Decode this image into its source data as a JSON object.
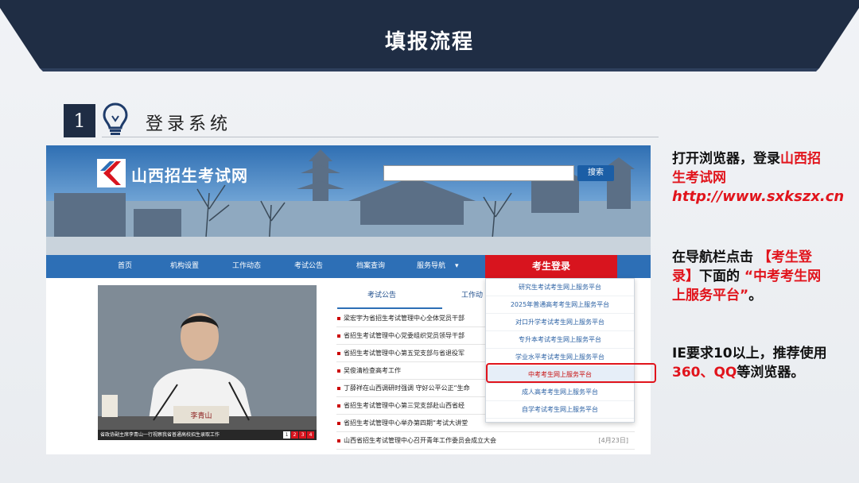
{
  "slide": {
    "title": "填报流程",
    "step_number": "1",
    "step_title": "登录系统"
  },
  "site": {
    "name": "山西招生考试网",
    "search_placeholder": "",
    "search_button": "搜索"
  },
  "nav": {
    "items": [
      "首页",
      "机构设置",
      "工作动态",
      "考试公告",
      "档案查询",
      "服务导航"
    ],
    "login": "考生登录",
    "dropdown_caret": "▾"
  },
  "photo": {
    "caption": "省政协副主席李青山一行视察我省普通高校招生录取工作",
    "name_plate": "李青山",
    "pages": [
      "1",
      "2",
      "3",
      "4"
    ]
  },
  "tabs": {
    "announcements": "考试公告",
    "news": "工作动"
  },
  "news": [
    {
      "title": "梁宏宇为省招生考试管理中心全体党员干部",
      "date": ""
    },
    {
      "title": "省招生考试管理中心党委组织党员领导干部",
      "date": ""
    },
    {
      "title": "省招生考试管理中心第五党支部与省退役军",
      "date": ""
    },
    {
      "title": "吴俊清检查高考工作",
      "date": ""
    },
    {
      "title": "丁薛祥在山西调研时强调 守好公平公正“生命",
      "date": ""
    },
    {
      "title": "省招生考试管理中心第三党支部赴山西省经",
      "date": ""
    },
    {
      "title": "省招生考试管理中心举办第四期“考试大讲堂",
      "date": ""
    },
    {
      "title": "山西省招生考试管理中心召开青年工作委员会成立大会",
      "date": "[4月23日]"
    }
  ],
  "dropdown": [
    "研究生考试考生网上服务平台",
    "2025年普通高考考生网上服务平台",
    "对口升学考试考生网上服务平台",
    "专升本考试考生网上服务平台",
    "学业水平考试考生网上服务平台",
    "中考考生网上服务平台",
    "成人高考考生网上服务平台",
    "自学考试考生网上服务平台"
  ],
  "dropdown_active_index": 5,
  "instructions": {
    "p1_prefix": "打开浏览器，登录",
    "p1_site": "山西招生考试网",
    "p1_url": "http://www.sxkszx.cn",
    "p2_prefix": "在导航栏点击",
    "p2_login": "【考生登录】",
    "p2_mid": "下面的",
    "p2_platform": "“中考考生网上服务平台”",
    "p2_end": "。",
    "p3_a": "IE要求10以上，推荐使用",
    "p3_b": "360、QQ",
    "p3_c": "等浏览器。"
  },
  "colors": {
    "header_band": "#1f2d44",
    "accent_red": "#e1141c",
    "nav_blue": "#2d6fb6"
  }
}
